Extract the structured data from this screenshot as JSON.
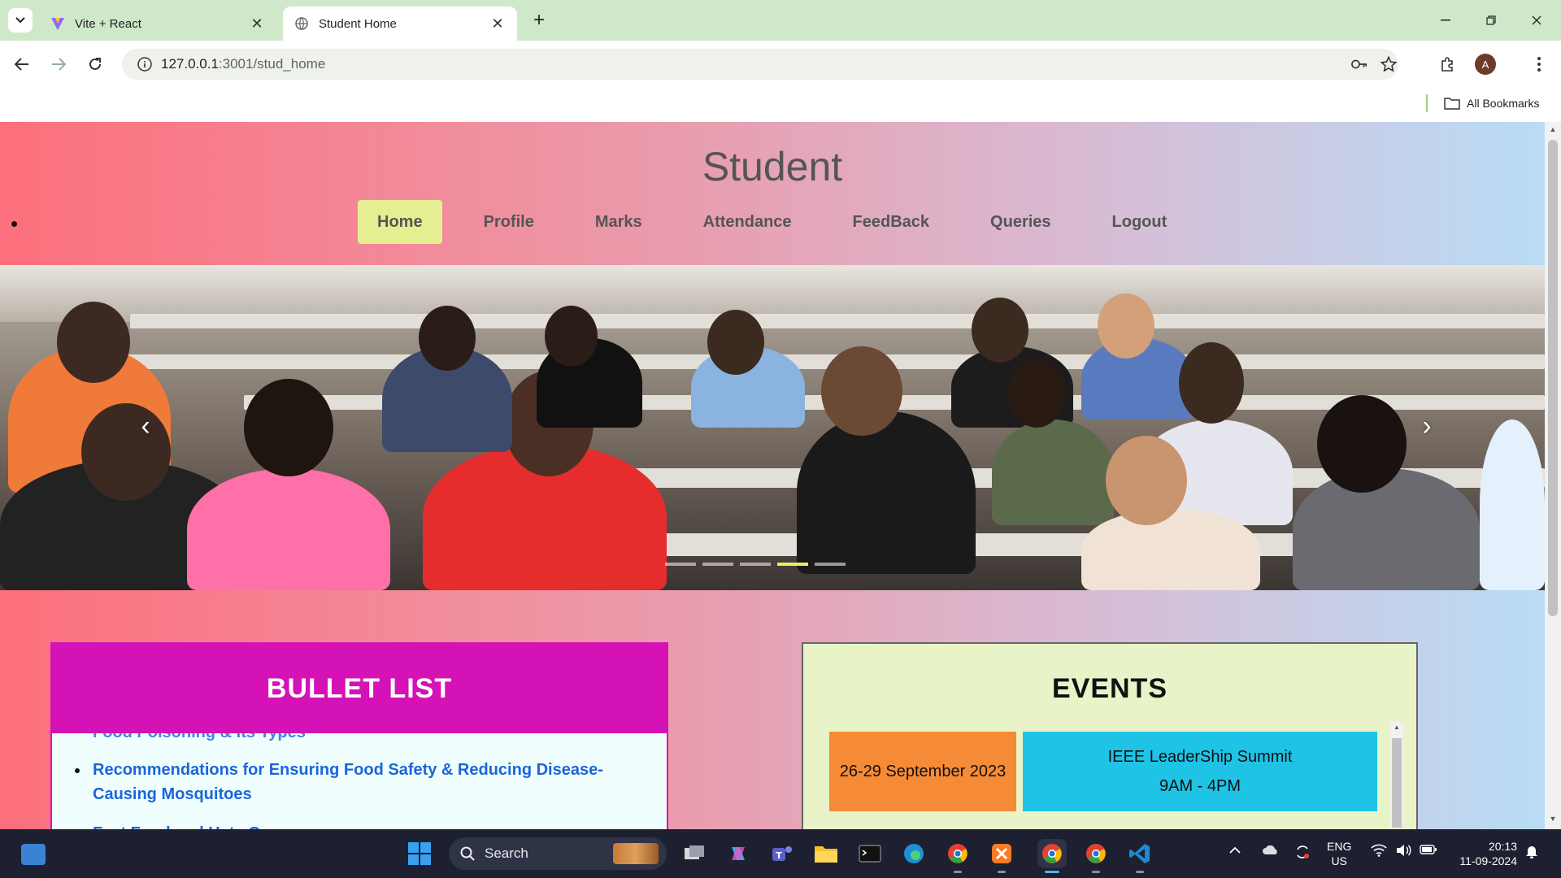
{
  "browser": {
    "tabs": [
      {
        "title": "Vite + React",
        "active": false
      },
      {
        "title": "Student Home",
        "active": true
      }
    ],
    "url_host": "127.0.0.1",
    "url_path": ":3001/stud_home",
    "bookmarks_label": "All Bookmarks",
    "profile_initial": "A"
  },
  "site": {
    "title": "Student",
    "nav": [
      {
        "label": "Home",
        "active": true
      },
      {
        "label": "Profile"
      },
      {
        "label": "Marks"
      },
      {
        "label": "Attendance"
      },
      {
        "label": "FeedBack"
      },
      {
        "label": "Queries"
      },
      {
        "label": "Logout"
      }
    ],
    "carousel": {
      "slide_count": 5,
      "active_index": 3
    }
  },
  "bullet_list": {
    "title": "BULLET LIST",
    "partial_top_item": "Food Poisoning & Its Types",
    "items": [
      "Recommendations for Ensuring Food Safety & Reducing Disease-Causing Mosquitoes",
      "Fast Food and Hate Groups"
    ]
  },
  "events": {
    "title": "EVENTS",
    "items": [
      {
        "date": "26-29 September 2023",
        "name": "IEEE LeaderShip Summit",
        "time": "9AM - 4PM"
      }
    ]
  },
  "taskbar": {
    "search_placeholder": "Search",
    "lang_line1": "ENG",
    "lang_line2": "US",
    "time": "20:13",
    "date": "11-09-2024"
  },
  "colors": {
    "nav_active": "#e5ee91",
    "bullet_header": "#d412b6",
    "event_date": "#f58b37",
    "event_body": "#1ec3e5",
    "events_bg": "#e8f3c8"
  }
}
